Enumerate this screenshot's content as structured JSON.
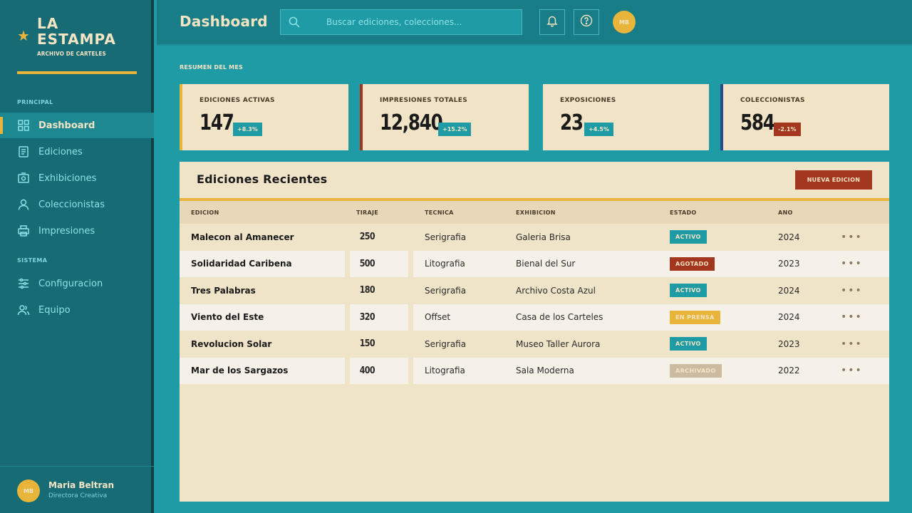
{
  "app": {
    "name_line1": "LA",
    "name_line2": "ESTAMPA",
    "subtitle": "ARCHIVO DE CARTELES"
  },
  "sidebar": {
    "sections": [
      {
        "label": "PRINCIPAL"
      },
      {
        "label": "SISTEMA"
      }
    ],
    "items": [
      {
        "label": "Dashboard",
        "icon": "grid-icon",
        "active": true
      },
      {
        "label": "Ediciones",
        "icon": "document-icon"
      },
      {
        "label": "Exhibiciones",
        "icon": "easel-icon"
      },
      {
        "label": "Coleccionistas",
        "icon": "user-icon"
      },
      {
        "label": "Impresiones",
        "icon": "printer-icon"
      },
      {
        "label": "Configuracion",
        "icon": "sliders-icon"
      },
      {
        "label": "Equipo",
        "icon": "team-icon"
      }
    ]
  },
  "user": {
    "initials": "MB",
    "name": "Maria Beltran",
    "role": "Directora Creativa"
  },
  "header": {
    "title": "Dashboard",
    "search_placeholder": "Buscar ediciones, colecciones...",
    "avatar_initials": "MB"
  },
  "summary": {
    "label": "RESUMEN DEL MES",
    "cards": [
      {
        "label": "EDICIONES ACTIVAS",
        "value": "147",
        "change": "+8.3%",
        "accent": "#e8b53a",
        "change_color": "#1f9ba6"
      },
      {
        "label": "IMPRESIONES TOTALES",
        "value": "12,840",
        "change": "+15.2%",
        "accent": "#a3361f",
        "change_color": "#1f9ba6"
      },
      {
        "label": "EXPOSICIONES",
        "value": "23",
        "change": "+4.5%",
        "accent": "#1f9ba6",
        "change_color": "#1f9ba6"
      },
      {
        "label": "COLECCIONISTAS",
        "value": "584",
        "change": "-2.1%",
        "accent": "#2a4a8f",
        "change_color": "#a3361f"
      }
    ]
  },
  "recent": {
    "title": "Ediciones Recientes",
    "new_button": "NUEVA EDICION",
    "columns": [
      "EDICION",
      "TIRAJE",
      "TECNICA",
      "EXHIBICION",
      "ESTADO",
      "ANO"
    ],
    "rows": [
      {
        "edicion": "Malecon al Amanecer",
        "tiraje": "250",
        "tecnica": "Serigrafia",
        "exhibicion": "Galeria Brisa",
        "estado": "ACTIVO",
        "estado_color": "#1f9ba6",
        "ano": "2024"
      },
      {
        "edicion": "Solidaridad Caribena",
        "tiraje": "500",
        "tecnica": "Litografia",
        "exhibicion": "Bienal del Sur",
        "estado": "AGOTADO",
        "estado_color": "#a3361f",
        "ano": "2023"
      },
      {
        "edicion": "Tres Palabras",
        "tiraje": "180",
        "tecnica": "Serigrafia",
        "exhibicion": "Archivo Costa Azul",
        "estado": "ACTIVO",
        "estado_color": "#1f9ba6",
        "ano": "2024"
      },
      {
        "edicion": "Viento del Este",
        "tiraje": "320",
        "tecnica": "Offset",
        "exhibicion": "Casa de los Carteles",
        "estado": "EN PRENSA",
        "estado_color": "#e8b53a",
        "ano": "2024"
      },
      {
        "edicion": "Revolucion Solar",
        "tiraje": "150",
        "tecnica": "Serigrafia",
        "exhibicion": "Museo Taller Aurora",
        "estado": "ACTIVO",
        "estado_color": "#1f9ba6",
        "ano": "2023"
      },
      {
        "edicion": "Mar de los Sargazos",
        "tiraje": "400",
        "tecnica": "Litografia",
        "exhibicion": "Sala Moderna",
        "estado": "ARCHIVADO",
        "estado_color": "#cbbba0",
        "ano": "2022"
      }
    ],
    "row_action": "..."
  }
}
